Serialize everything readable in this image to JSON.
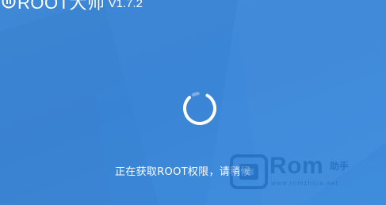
{
  "window": {
    "app_name": "ROOT大师",
    "version": "V1.7.2",
    "background_color": "#3e88d6"
  },
  "loading": {
    "status_text": "正在获取ROOT权限，请稍候",
    "spinner_color": "#ffffff"
  },
  "watermark": {
    "brand": "Rom",
    "brand_suffix": "助手",
    "url": "www.romzhijia.net",
    "color": "#1a5fb0"
  }
}
